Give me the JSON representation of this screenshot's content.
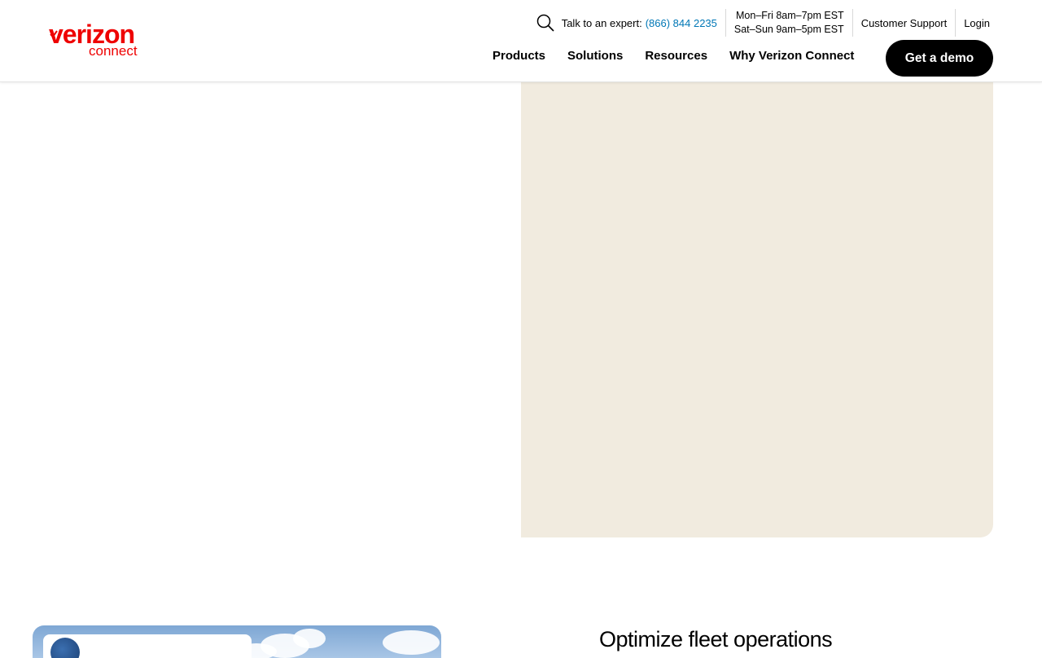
{
  "brand": {
    "name": "verizon",
    "sub": "connect",
    "color": "#ee0000"
  },
  "utility": {
    "search_icon": "search-icon",
    "expert_label": "Talk to an expert:",
    "phone": "(866) 844 2235",
    "hours_weekday": "Mon–Fri 8am–7pm EST",
    "hours_weekend": "Sat–Sun 9am–5pm EST",
    "customer_support": "Customer Support",
    "login": "Login"
  },
  "nav": {
    "items": [
      {
        "label": "Products"
      },
      {
        "label": "Solutions"
      },
      {
        "label": "Resources"
      },
      {
        "label": "Why Verizon Connect"
      }
    ]
  },
  "cta": {
    "demo_label": "Get a demo"
  },
  "section": {
    "heading": "Optimize fleet operations"
  },
  "colors": {
    "accent_link": "#0077b6",
    "panel_bg": "#f1ebdf",
    "button_bg": "#000000"
  }
}
